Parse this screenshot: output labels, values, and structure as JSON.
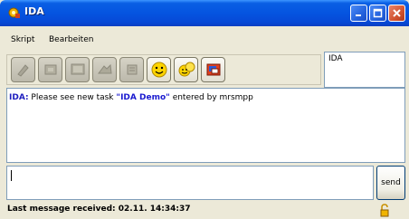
{
  "window": {
    "title": "IDA",
    "app_icon": "ida-gear-icon",
    "controls": {
      "minimize": "minimize-icon",
      "maximize": "maximize-icon",
      "close": "close-icon"
    }
  },
  "menu": {
    "items": [
      {
        "label": "Skript"
      },
      {
        "label": "Bearbeiten"
      }
    ]
  },
  "toolbar": {
    "buttons": [
      {
        "icon": "tool-1-icon",
        "state": "disabled"
      },
      {
        "icon": "tool-2-icon",
        "state": "disabled"
      },
      {
        "icon": "tool-3-icon",
        "state": "disabled"
      },
      {
        "icon": "tool-4-icon",
        "state": "disabled"
      },
      {
        "icon": "tool-5-icon",
        "state": "disabled"
      },
      {
        "icon": "smiley-icon",
        "state": "active"
      },
      {
        "icon": "chat-faces-icon",
        "state": "active"
      },
      {
        "icon": "flag-icon",
        "state": "active"
      }
    ]
  },
  "nick": {
    "value": "IDA"
  },
  "messages": [
    {
      "sender": "IDA:",
      "text_before": " Please see new task ",
      "highlight": "\"IDA Demo\"",
      "text_after": " entered by mrsmpp"
    }
  ],
  "input": {
    "value": "",
    "placeholder": ""
  },
  "send_button": {
    "label": "send"
  },
  "status": {
    "text": "Last message received: 02.11. 14:34:37"
  },
  "colors": {
    "titlebar": "#0554e0",
    "window_bg": "#ece9d8",
    "sender": "#2020c0",
    "highlight": "#1a1ad0"
  }
}
